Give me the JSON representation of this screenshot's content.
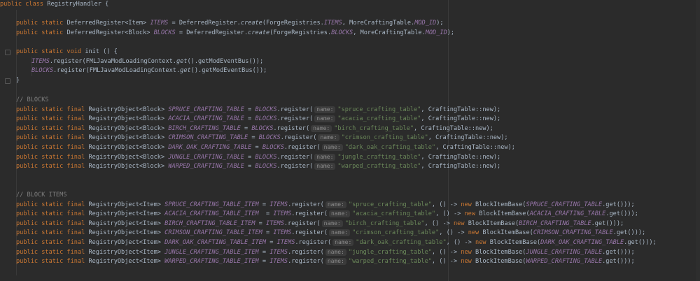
{
  "code": {
    "class_decl": {
      "kw": "public class",
      "name": "RegistryHandler {"
    },
    "items_field": {
      "pre": "public static DeferredRegister<Item> ",
      "name": "ITEMS",
      "mid": " = DeferredRegister.",
      "method": "create",
      "args_pre": "(ForgeRegistries.",
      "arg_field": "ITEMS",
      "args_mid": ", MoreCraftingTable.",
      "arg_const": "MOD_ID",
      "end": ");"
    },
    "blocks_field": {
      "pre": "public static DeferredRegister<Block> ",
      "name": "BLOCKS",
      "mid": " = DeferredRegister.",
      "method": "create",
      "args_pre": "(ForgeRegistries.",
      "arg_field": "BLOCKS",
      "args_mid": ", MoreCraftingTable.",
      "arg_const": "MOD_ID",
      "end": ");"
    },
    "init_decl": {
      "kw": "public static void",
      "rest": " init () {"
    },
    "init_items": {
      "field": "ITEMS",
      "pre": ".register(FMLJavaModLoadingContext.",
      "method": "get",
      "end": "().getModEventBus());"
    },
    "init_blocks": {
      "field": "BLOCKS",
      "pre": ".register(FMLJavaModLoadingContext.",
      "method": "get",
      "end": "().getModEventBus());"
    },
    "close_brace": "}",
    "comment_blocks": "// BLOCKS",
    "comment_items": "// BLOCK ITEMS",
    "block_decls": [
      {
        "kw": "public static final",
        "type": " RegistryObject<Block> ",
        "name": "SPRUCE_CRAFTING_TABLE",
        "eq": " = ",
        "reg": "BLOCKS",
        "call": ".register(",
        "hint": "name:",
        "str": "\"spruce_crafting_table\"",
        "end": ", CraftingTable::new);"
      },
      {
        "kw": "public static final",
        "type": " RegistryObject<Block> ",
        "name": "ACACIA_CRAFTING_TABLE",
        "eq": " = ",
        "reg": "BLOCKS",
        "call": ".register(",
        "hint": "name:",
        "str": "\"acacia_crafting_table\"",
        "end": ", CraftingTable::new);"
      },
      {
        "kw": "public static final",
        "type": " RegistryObject<Block> ",
        "name": "BIRCH_CRAFTING_TABLE",
        "eq": " = ",
        "reg": "BLOCKS",
        "call": ".register(",
        "hint": "name:",
        "str": "\"birch_crafting_table\"",
        "end": ", CraftingTable::new);"
      },
      {
        "kw": "public static final",
        "type": " RegistryObject<Block> ",
        "name": "CRIMSON_CRAFTING_TABLE",
        "eq": " = ",
        "reg": "BLOCKS",
        "call": ".register(",
        "hint": "name:",
        "str": "\"crimson_crafting_table\"",
        "end": ", CraftingTable::new);"
      },
      {
        "kw": "public static final",
        "type": " RegistryObject<Block> ",
        "name": "DARK_OAK_CRAFTING_TABLE",
        "eq": " = ",
        "reg": "BLOCKS",
        "call": ".register(",
        "hint": "name:",
        "str": "\"dark_oak_crafting_table\"",
        "end": ", CraftingTable::new);"
      },
      {
        "kw": "public static final",
        "type": " RegistryObject<Block> ",
        "name": "JUNGLE_CRAFTING_TABLE",
        "eq": " = ",
        "reg": "BLOCKS",
        "call": ".register(",
        "hint": "name:",
        "str": "\"jungle_crafting_table\"",
        "end": ", CraftingTable::new);"
      },
      {
        "kw": "public static final",
        "type": " RegistryObject<Block> ",
        "name": "WARPED_CRAFTING_TABLE",
        "eq": " = ",
        "reg": "BLOCKS",
        "call": ".register(",
        "hint": "name:",
        "str": "\"warped_crafting_table\"",
        "end": ", CraftingTable::new);"
      }
    ],
    "item_decls": [
      {
        "kw": "public static final",
        "type": " RegistryObject<Item> ",
        "name": "SPRUCE_CRAFTING_TABLE_ITEM",
        "eq": " = ",
        "reg": "ITEMS",
        "call": ".register(",
        "hint": "name:",
        "str": "\"spruce_crafting_table\"",
        "lam": ", () -> ",
        "newkw": "new",
        "ctor": " BlockItemBase(",
        "arg": "SPRUCE_CRAFTING_TABLE",
        "end": ".get()));"
      },
      {
        "kw": "public static final",
        "type": " RegistryObject<Item> ",
        "name": "ACACIA_CRAFTING_TABLE_ITEM",
        "eq": "  = ",
        "reg": "ITEMS",
        "call": ".register(",
        "hint": "name:",
        "str": "\"acacia_crafting_table\"",
        "lam": ", () -> ",
        "newkw": "new",
        "ctor": " BlockItemBase(",
        "arg": "ACACIA_CRAFTING_TABLE",
        "end": ".get()));"
      },
      {
        "kw": "public static final",
        "type": " RegistryObject<Item> ",
        "name": "BIRCH_CRAFTING_TABLE_ITEM",
        "eq": " = ",
        "reg": "ITEMS",
        "call": ".register(",
        "hint": "name:",
        "str": "\"birch_crafting_table\"",
        "lam": ", () -> ",
        "newkw": "new",
        "ctor": " BlockItemBase(",
        "arg": "BIRCH_CRAFTING_TABLE",
        "end": ".get()));"
      },
      {
        "kw": "public static final",
        "type": " RegistryObject<Item> ",
        "name": "CRIMSON_CRAFTING_TABLE_ITEM",
        "eq": " = ",
        "reg": "ITEMS",
        "call": ".register(",
        "hint": "name:",
        "str": "\"crimson_crafting_table\"",
        "lam": ", () -> ",
        "newkw": "new",
        "ctor": " BlockItemBase(",
        "arg": "CRIMSON_CRAFTING_TABLE",
        "end": ".get()));"
      },
      {
        "kw": "public static final",
        "type": " RegistryObject<Item> ",
        "name": "DARK_OAK_CRAFTING_TABLE_ITEM",
        "eq": " = ",
        "reg": "ITEMS",
        "call": ".register(",
        "hint": "name:",
        "str": "\"dark_oak_crafting_table\"",
        "lam": ", () -> ",
        "newkw": "new",
        "ctor": " BlockItemBase(",
        "arg": "DARK_OAK_CRAFTING_TABLE",
        "end": ".get()));"
      },
      {
        "kw": "public static final",
        "type": " RegistryObject<Item> ",
        "name": "JUNGLE_CRAFTING_TABLE_ITEM",
        "eq": " = ",
        "reg": "ITEMS",
        "call": ".register(",
        "hint": "name:",
        "str": "\"jungle_crafting_table\"",
        "lam": ", () -> ",
        "newkw": "new",
        "ctor": " BlockItemBase(",
        "arg": "JUNGLE_CRAFTING_TABLE",
        "end": ".get()));"
      },
      {
        "kw": "public static final",
        "type": " RegistryObject<Item> ",
        "name": "WARPED_CRAFTING_TABLE_ITEM",
        "eq": " = ",
        "reg": "ITEMS",
        "call": ".register(",
        "hint": "name:",
        "str": "\"warped_crafting_table\"",
        "lam": ", () -> ",
        "newkw": "new",
        "ctor": " BlockItemBase(",
        "arg": "WARPED_CRAFTING_TABLE",
        "end": ".get()));"
      }
    ]
  },
  "colors": {
    "background": "#2b2b2b",
    "text": "#a9b7c6",
    "keyword": "#cc7832",
    "field": "#9876aa",
    "string": "#6a8759",
    "comment": "#808080"
  }
}
